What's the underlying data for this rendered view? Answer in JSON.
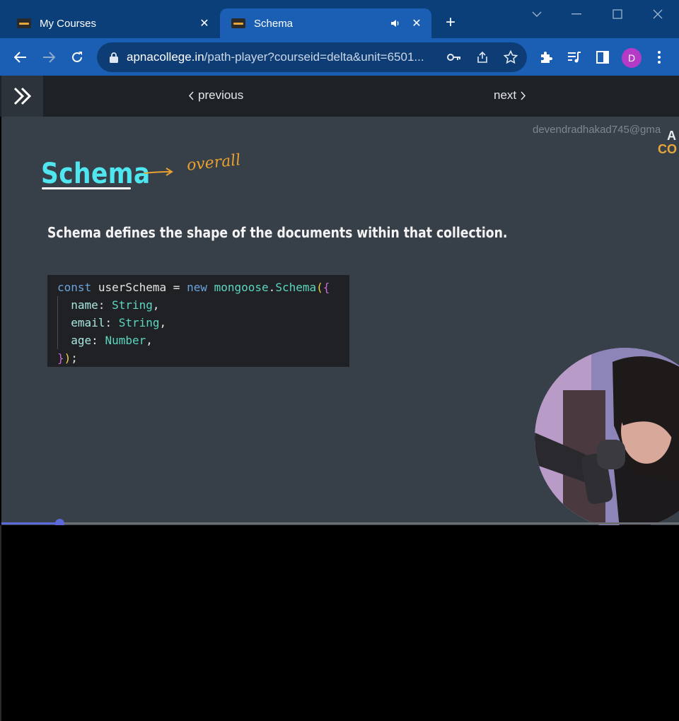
{
  "browser": {
    "tabs": [
      {
        "title": "My Courses",
        "active": false
      },
      {
        "title": "Schema",
        "active": true,
        "audio": true
      }
    ],
    "url_domain": "apnacollege.in",
    "url_path": "/path-player?courseid=delta&unit=6501...",
    "profile_initial": "D",
    "colors": {
      "tabstrip": "#0b3f7a",
      "toolbar": "#1b5fb5",
      "avatar": "#b53ac7"
    }
  },
  "pagebar": {
    "previous_label": "previous",
    "next_label": "next"
  },
  "video": {
    "watermark": "devendradhakad745@gma",
    "logo_line1": "A",
    "logo_line2": "CO",
    "slide_title": "Schema",
    "annotation": "overall",
    "description": "Schema defines the shape of the documents within that collection.",
    "code": {
      "line1": {
        "kw1": "const",
        "var": "userSchema",
        "eq": "=",
        "kw2": "new",
        "obj": "mongoose",
        "dot": ".",
        "cls": "Schema",
        "open1": "(",
        "open2": "{"
      },
      "fields": [
        {
          "name": "name",
          "type": "String",
          "sep": ","
        },
        {
          "name": "email",
          "type": "String",
          "sep": ","
        },
        {
          "name": "age",
          "type": "Number",
          "sep": ","
        }
      ],
      "close": {
        "brace": "}",
        "paren": ")",
        "semi": ";"
      }
    },
    "progress_fraction": 0.086
  }
}
